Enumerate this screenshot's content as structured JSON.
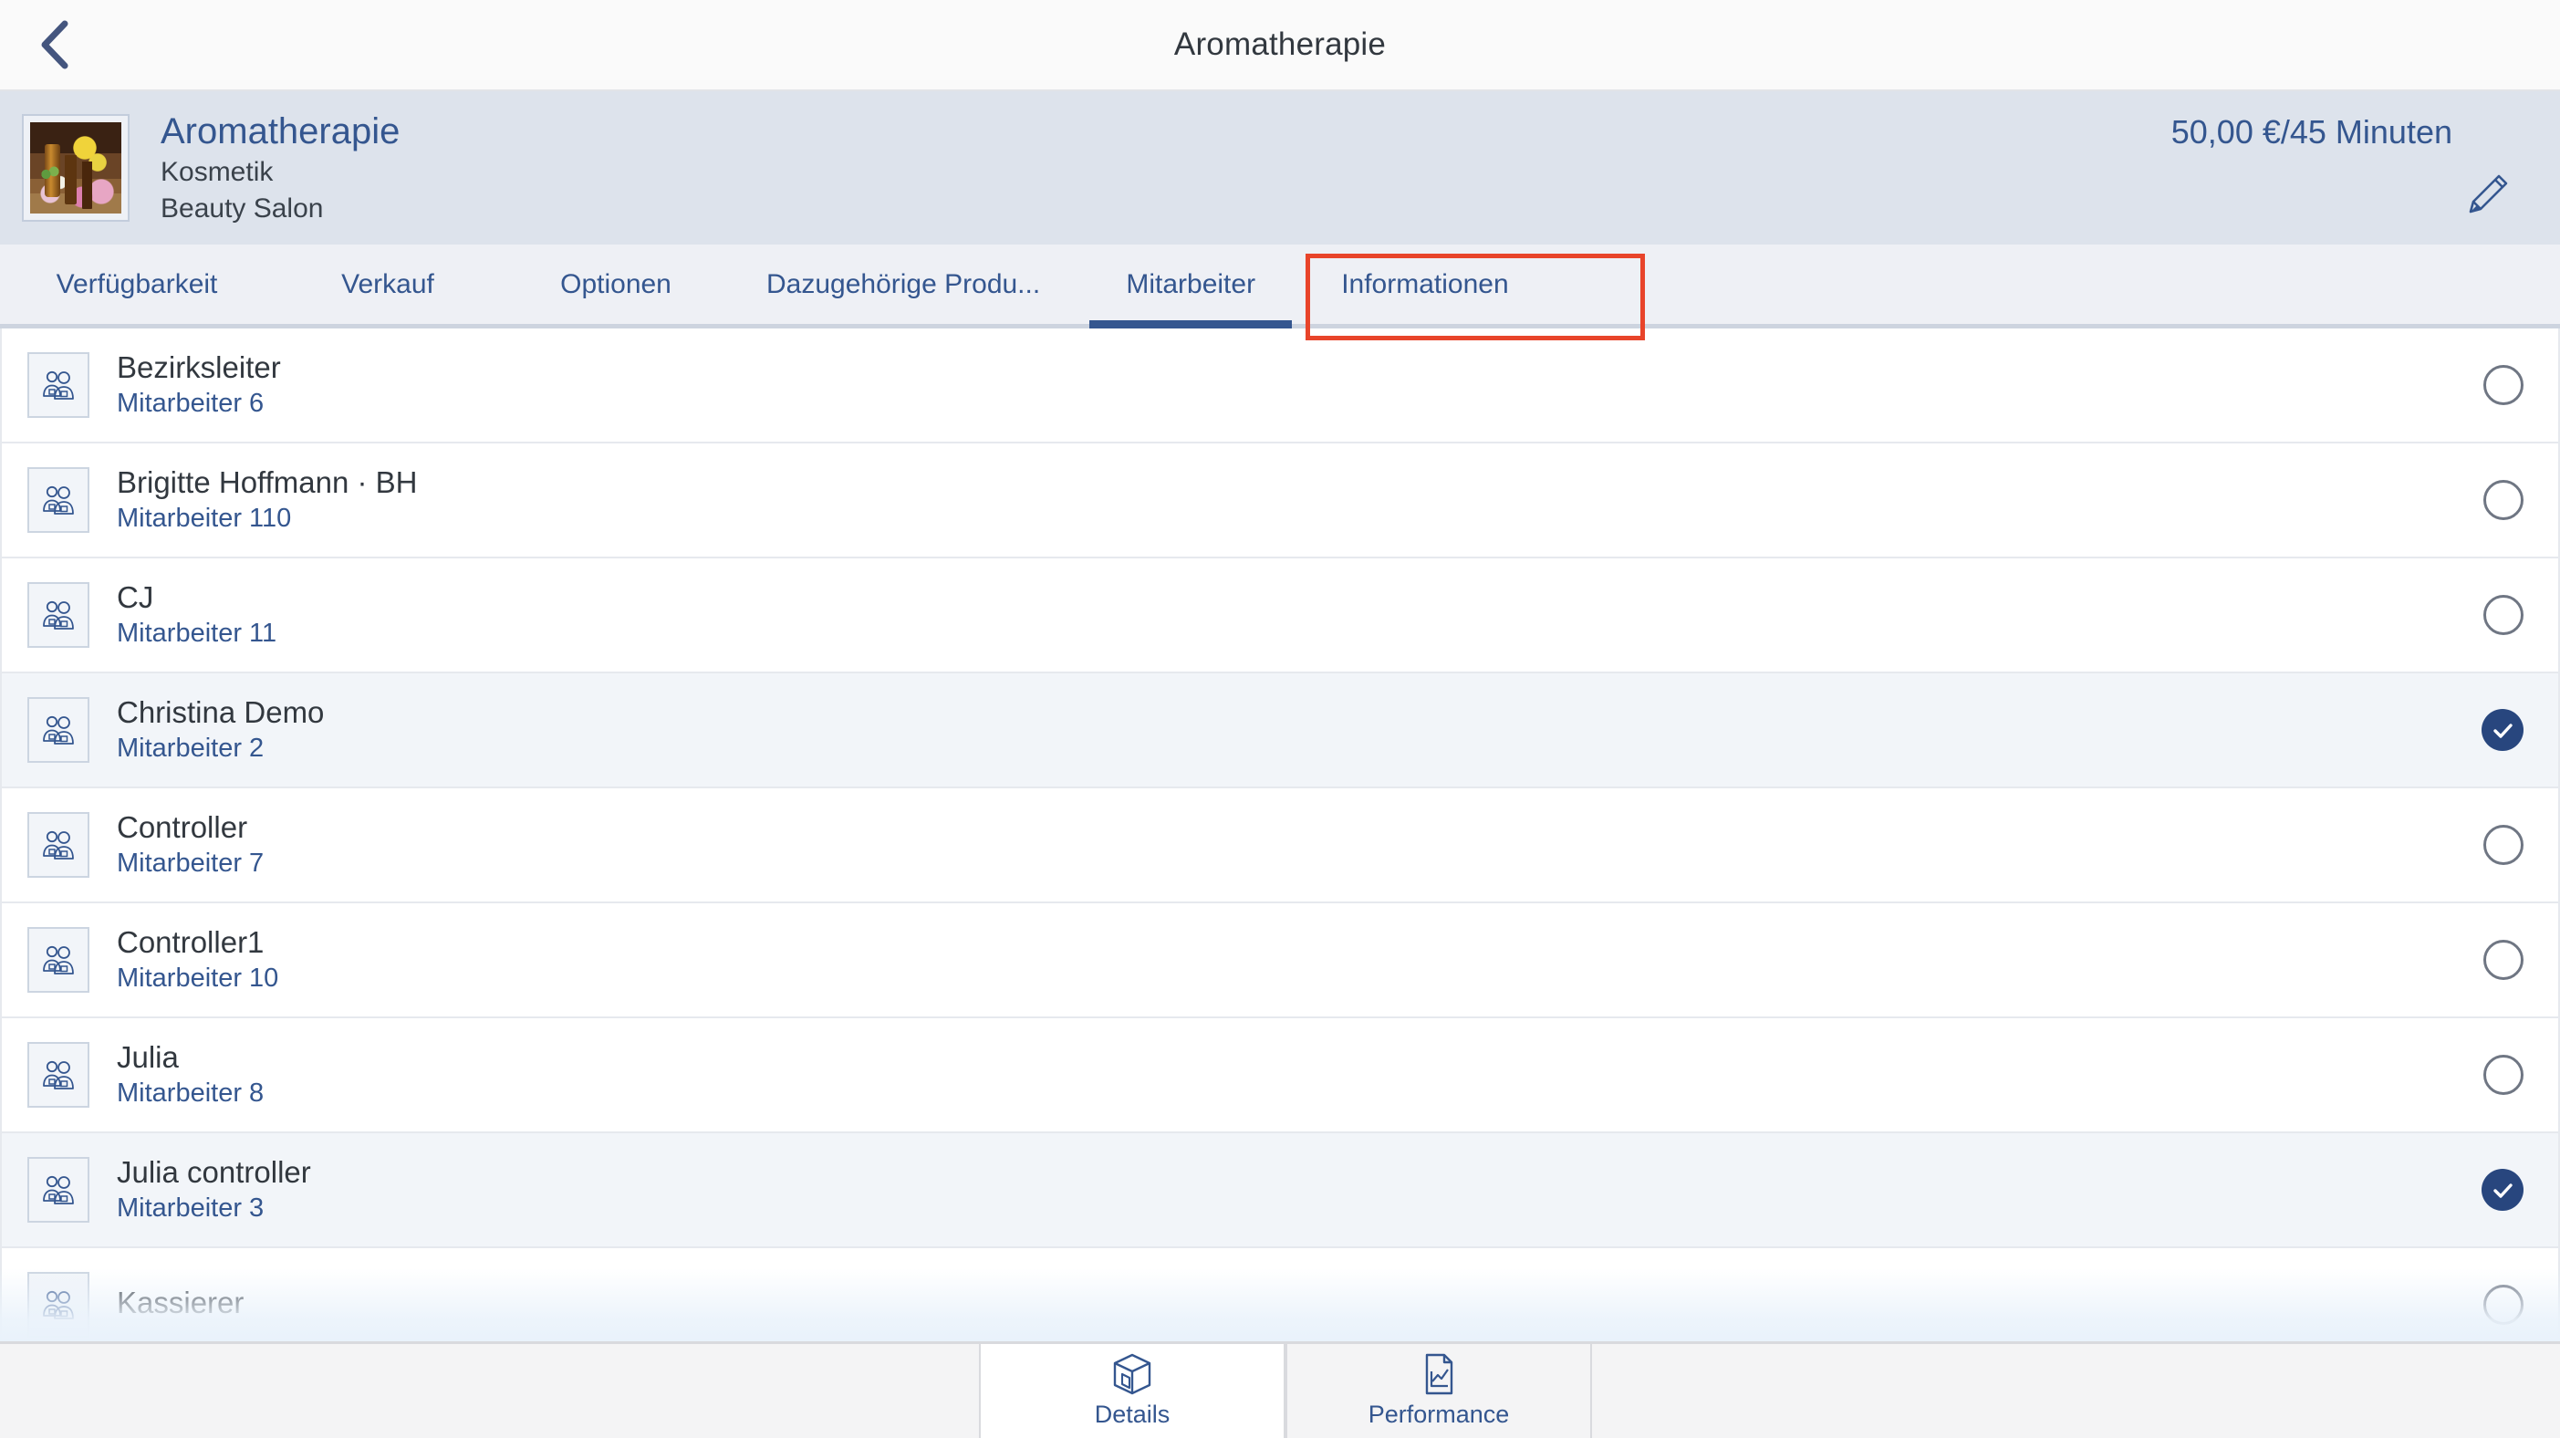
{
  "navbar": {
    "back_icon": "chevron-left-icon",
    "title": "Aromatherapie"
  },
  "object_header": {
    "thumbnail_icon": "product-thumbnail-aromatherapy",
    "title": "Aromatherapie",
    "category": "Kosmetik",
    "location": "Beauty Salon",
    "price": "50,00 €/45 Minuten",
    "edit_icon": "pencil-edit-icon"
  },
  "tabs": [
    {
      "label": "Verfügbarkeit",
      "active": false
    },
    {
      "label": "Verkauf",
      "active": false
    },
    {
      "label": "Optionen",
      "active": false
    },
    {
      "label": "Dazugehörige Produ...",
      "active": false
    },
    {
      "label": "Mitarbeiter",
      "active": true
    },
    {
      "label": "Informationen",
      "active": false
    }
  ],
  "annotation": {
    "type": "highlight-box",
    "target": "Mitarbeiter",
    "color": "#e8442a"
  },
  "employee_list": {
    "row_icon": "employees-group-icon",
    "rows": [
      {
        "name": "Bezirksleiter",
        "subtitle": "Mitarbeiter 6",
        "selected": false
      },
      {
        "name": "Brigitte Hoffmann · BH",
        "subtitle": "Mitarbeiter 110",
        "selected": false
      },
      {
        "name": "CJ",
        "subtitle": "Mitarbeiter 11",
        "selected": false
      },
      {
        "name": "Christina Demo",
        "subtitle": "Mitarbeiter 2",
        "selected": true
      },
      {
        "name": "Controller",
        "subtitle": "Mitarbeiter 7",
        "selected": false
      },
      {
        "name": "Controller1",
        "subtitle": "Mitarbeiter 10",
        "selected": false
      },
      {
        "name": "Julia",
        "subtitle": "Mitarbeiter 8",
        "selected": false
      },
      {
        "name": "Julia controller",
        "subtitle": "Mitarbeiter 3",
        "selected": true
      },
      {
        "name": "Kassierer",
        "subtitle": "",
        "selected": false
      }
    ]
  },
  "bottom_bar": {
    "items": [
      {
        "label": "Details",
        "icon": "box-3d-icon",
        "active": true
      },
      {
        "label": "Performance",
        "icon": "chart-document-icon",
        "active": false
      }
    ]
  },
  "colors": {
    "accent_blue": "#34568f",
    "selected_fill": "#28467e",
    "header_bg": "#dde3ec",
    "tab_bg": "#eef0f5",
    "annotation_red": "#e8442a"
  }
}
